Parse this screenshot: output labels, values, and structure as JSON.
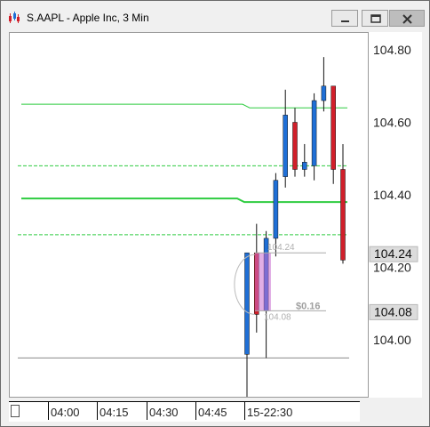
{
  "window": {
    "title": "S.AAPL - Apple Inc, 3 Min",
    "icon": "candlestick-app-icon",
    "controls": [
      "minimize-icon",
      "maximize-icon",
      "close-icon"
    ]
  },
  "colors": {
    "up_candle": "#1f6fd6",
    "down_candle": "#d11f2a",
    "ma_line": "#2ecc40",
    "ref_line": "#999999",
    "highlight": "#c86ed0"
  },
  "price_axis": {
    "ticks": [
      "104.80",
      "104.60",
      "104.40",
      "104.20",
      "104.00"
    ],
    "badges": [
      "104.24",
      "104.08"
    ]
  },
  "time_axis": {
    "labels": [
      "04:00",
      "04:15",
      "04:30",
      "04:45",
      "15-22:30"
    ]
  },
  "annotations": {
    "upper_level": "104.24",
    "lower_level": "104.08",
    "difference": "$0.16"
  },
  "chart_data": {
    "type": "candlestick",
    "title": "S.AAPL - Apple Inc, 3 Min",
    "ylim": [
      103.85,
      104.89
    ],
    "yticks": [
      104.8,
      104.6,
      104.4,
      104.2,
      104.0
    ],
    "candles": [
      {
        "open": 103.96,
        "high": 104.24,
        "low": 103.84,
        "close": 104.24,
        "dir": "up"
      },
      {
        "open": 104.24,
        "high": 104.32,
        "low": 104.02,
        "close": 104.07,
        "dir": "down"
      },
      {
        "open": 104.08,
        "high": 104.3,
        "low": 103.95,
        "close": 104.28,
        "dir": "up"
      },
      {
        "open": 104.28,
        "high": 104.46,
        "low": 104.23,
        "close": 104.44,
        "dir": "up"
      },
      {
        "open": 104.45,
        "high": 104.69,
        "low": 104.42,
        "close": 104.62,
        "dir": "up"
      },
      {
        "open": 104.6,
        "high": 104.64,
        "low": 104.45,
        "close": 104.47,
        "dir": "down"
      },
      {
        "open": 104.47,
        "high": 104.54,
        "low": 104.45,
        "close": 104.49,
        "dir": "up"
      },
      {
        "open": 104.48,
        "high": 104.68,
        "low": 104.44,
        "close": 104.66,
        "dir": "up"
      },
      {
        "open": 104.66,
        "high": 104.78,
        "low": 104.63,
        "close": 104.7,
        "dir": "up"
      },
      {
        "open": 104.7,
        "high": 104.7,
        "low": 104.43,
        "close": 104.47,
        "dir": "down"
      },
      {
        "open": 104.47,
        "high": 104.54,
        "low": 104.21,
        "close": 104.22,
        "dir": "down"
      }
    ],
    "ma_middle": 104.39,
    "ma_upper_before": 104.65,
    "ma_upper_after": 104.64,
    "ma_mid_before": 104.39,
    "ma_mid_after": 104.38,
    "band_upper": 104.48,
    "band_lower": 104.29,
    "ref_low": 103.95,
    "ref_top": 104.24,
    "ref_bottom": 104.08
  }
}
